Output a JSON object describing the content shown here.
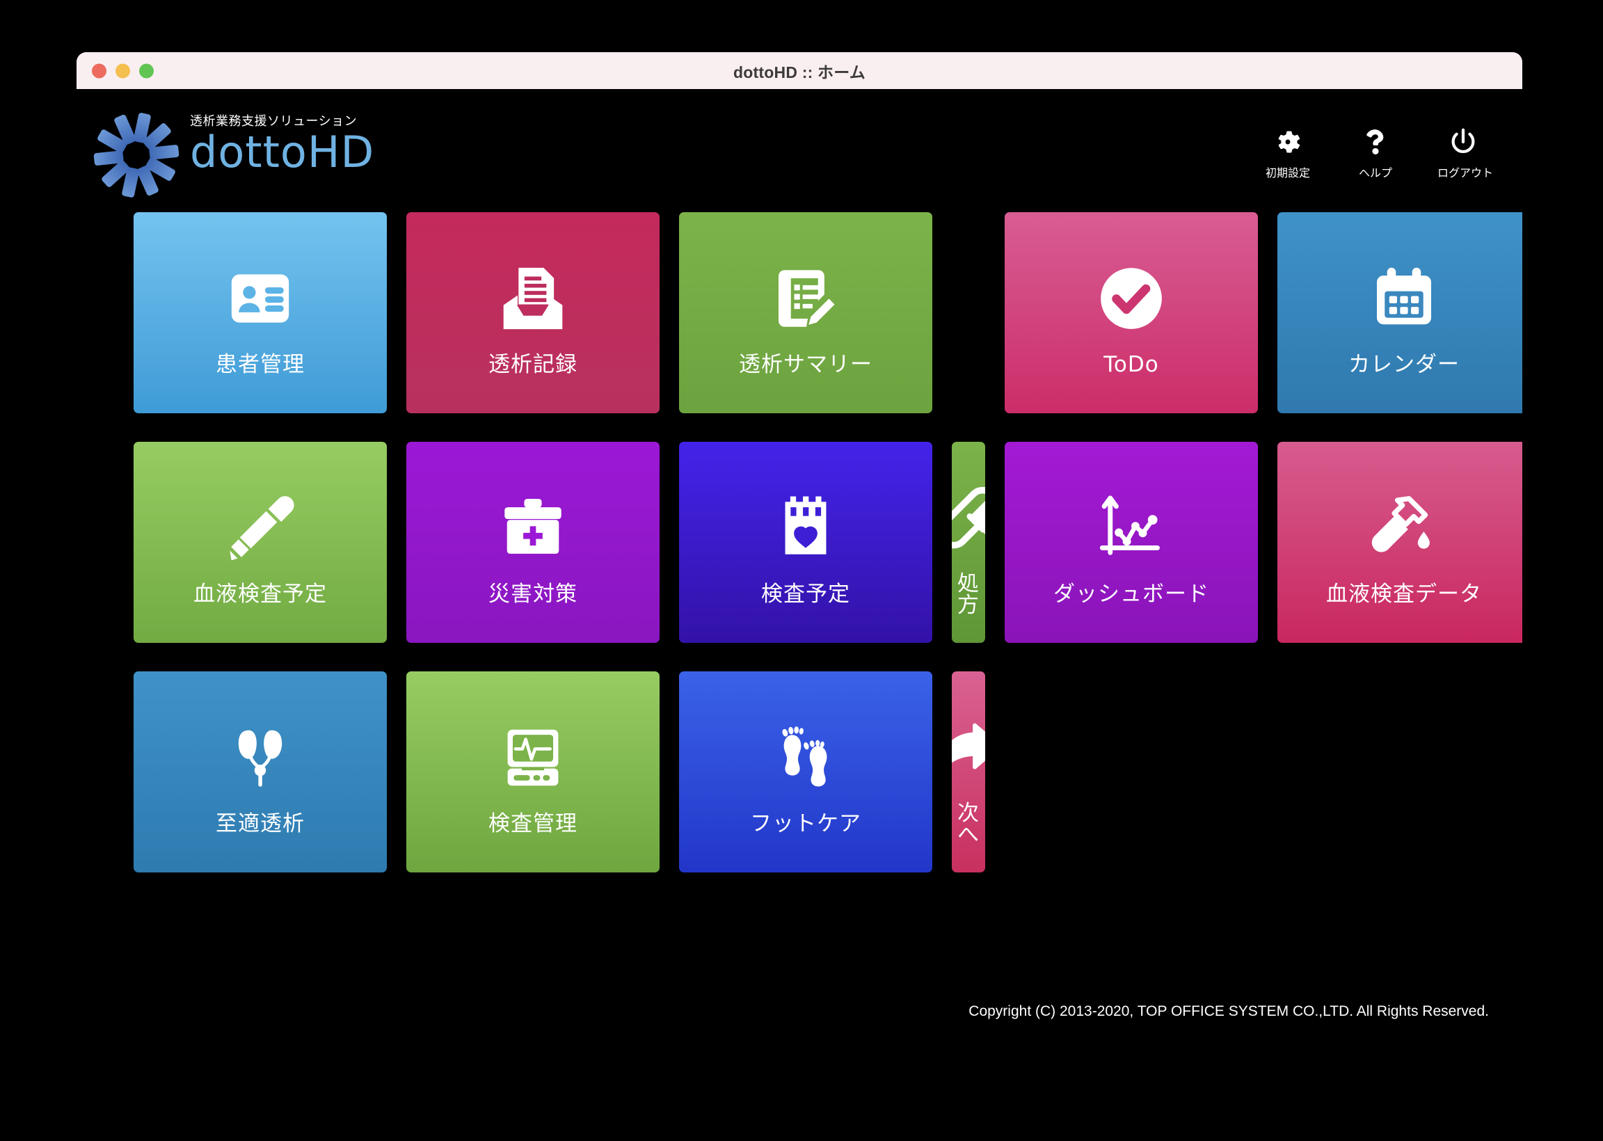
{
  "window": {
    "title": "dottoHD :: ホーム",
    "traffic_lights": [
      "close",
      "minimize",
      "zoom"
    ]
  },
  "header": {
    "tagline": "透析業務支援ソリューション",
    "wordmark": "dottoHD",
    "logo_icon": "sunburst-logo-icon",
    "actions": [
      {
        "label": "初期設定",
        "icon": "gear-icon"
      },
      {
        "label": "ヘルプ",
        "icon": "question-mark-icon"
      },
      {
        "label": "ログアウト",
        "icon": "power-icon"
      }
    ]
  },
  "tiles": [
    {
      "label": "患者管理",
      "icon": "id-card-icon",
      "color_top": "#74c3ef",
      "color_bottom": "#3f9bd6"
    },
    {
      "label": "透析記録",
      "icon": "document-tray-icon",
      "color_top": "#c42a5c",
      "color_bottom": "#b8315e"
    },
    {
      "label": "透析サマリー",
      "icon": "note-pencil-icon",
      "color_top": "#7cb34a",
      "color_bottom": "#6da33f"
    },
    {
      "label": "ToDo",
      "icon": "check-circle-icon",
      "color_top": "#d85d93",
      "color_bottom": "#cc2d69"
    },
    {
      "label": "カレンダー",
      "icon": "calendar-icon",
      "color_top": "#3f92c8",
      "color_bottom": "#2f79ae"
    },
    {
      "label": "血液検査予定",
      "icon": "dropper-icon",
      "color_top": "#96cc62",
      "color_bottom": "#72ab43"
    },
    {
      "label": "災害対策",
      "icon": "first-aid-kit-icon",
      "color_top": "#9b18d6",
      "color_bottom": "#8a17c0"
    },
    {
      "label": "検査予定",
      "icon": "calendar-heart-icon",
      "color_top": "#4423ea",
      "color_bottom": "#3312a8"
    },
    {
      "label": "処方",
      "icon": "pill-capsule-icon",
      "color_top": "#7cb34a",
      "color_bottom": "#5f9636"
    },
    {
      "label": "ダッシュボード",
      "icon": "line-chart-icon",
      "color_top": "#a31ad4",
      "color_bottom": "#8a14b8"
    },
    {
      "label": "血液検査データ",
      "icon": "test-tube-icon",
      "color_top": "#d75c8e",
      "color_bottom": "#c9275f"
    },
    {
      "label": "至適透析",
      "icon": "kidneys-icon",
      "color_top": "#3f92c8",
      "color_bottom": "#2e7bb0"
    },
    {
      "label": "検査管理",
      "icon": "monitor-ecg-icon",
      "color_top": "#96cc62",
      "color_bottom": "#6fa63f"
    },
    {
      "label": "フットケア",
      "icon": "footprints-icon",
      "color_top": "#3a62e8",
      "color_bottom": "#2236c9"
    },
    {
      "label": "次へ",
      "icon": "arrow-forward-icon",
      "color_top": "#d96292",
      "color_bottom": "#c8305f"
    }
  ],
  "footer": {
    "copyright": "Copyright (C) 2013-2020, TOP OFFICE SYSTEM CO.,LTD. All Rights Reserved."
  },
  "colors": {
    "page_background": "#000000",
    "titlebar_background": "#faeff0",
    "wordmark": "#6fb2e2",
    "logo_blue": "#4a74be"
  }
}
